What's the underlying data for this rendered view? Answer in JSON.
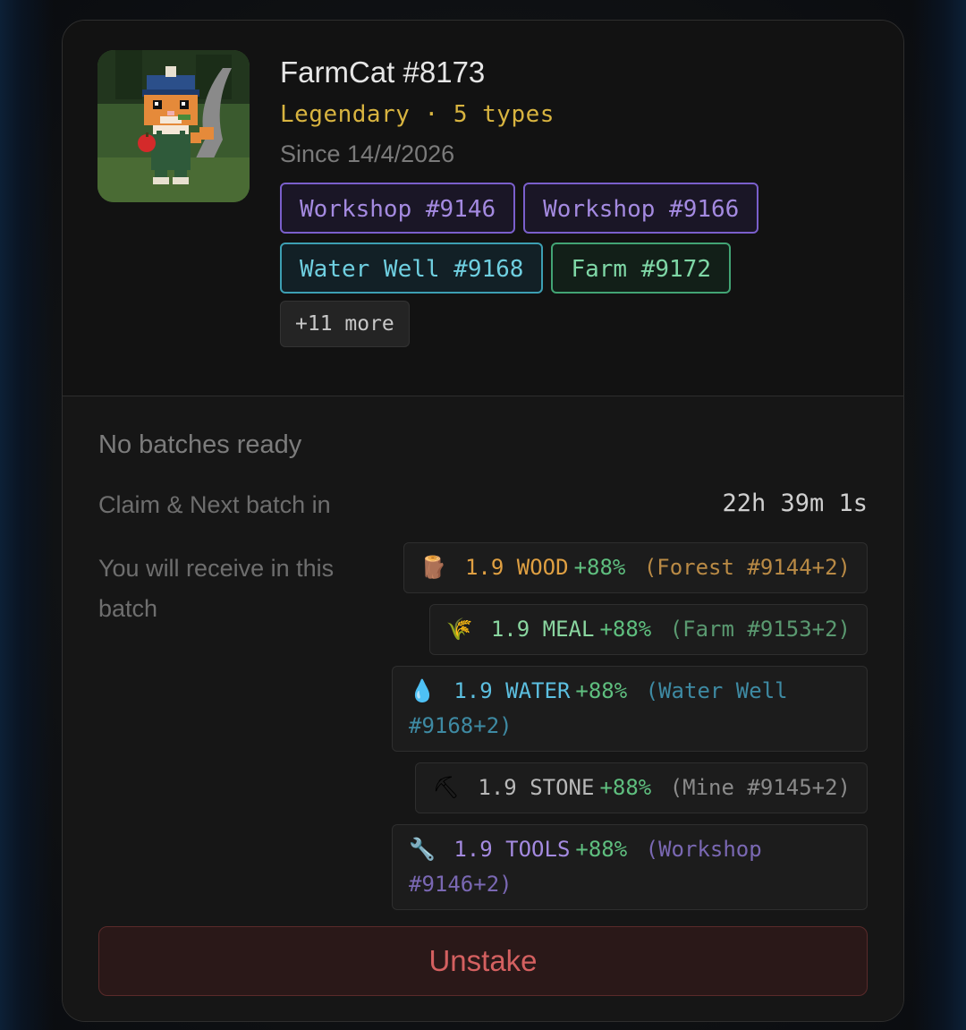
{
  "nft": {
    "title": "FarmCat #8173",
    "rarity": "Legendary · 5 types",
    "since": "Since 14/4/2026",
    "tags": [
      {
        "label": "Workshop #9146",
        "color": "purple"
      },
      {
        "label": "Workshop #9166",
        "color": "purple"
      },
      {
        "label": "Water Well #9168",
        "color": "cyan"
      },
      {
        "label": "Farm #9172",
        "color": "green"
      }
    ],
    "more": "+11 more",
    "avatar_icon": "pixel-cat-farmer"
  },
  "batch": {
    "status": "No batches ready",
    "claim_label": "Claim & Next batch in",
    "timer": "22h 39m 1s",
    "receive_label": "You will receive in this batch",
    "rewards": [
      {
        "icon": "🪵",
        "amount": "1.9",
        "resource": "WOOD",
        "bonus": "+88%",
        "source": "(Forest #9144+2)"
      },
      {
        "icon": "🌾",
        "amount": "1.9",
        "resource": "MEAL",
        "bonus": "+88%",
        "source": "(Farm #9153+2)"
      },
      {
        "icon": "💧",
        "amount": "1.9",
        "resource": "WATER",
        "bonus": "+88%",
        "source": "(Water Well #9168+2)"
      },
      {
        "icon": "⛏",
        "amount": "1.9",
        "resource": "STONE",
        "bonus": "+88%",
        "source": "(Mine #9145+2)"
      },
      {
        "icon": "🔧",
        "amount": "1.9",
        "resource": "TOOLS",
        "bonus": "+88%",
        "source": "(Workshop #9146+2)"
      }
    ]
  },
  "actions": {
    "unstake": "Unstake"
  }
}
